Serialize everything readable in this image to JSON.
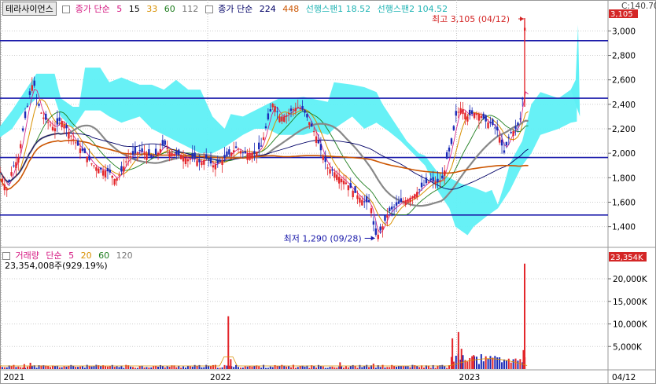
{
  "stock_name": "테라사이언스",
  "price_legend": {
    "ma_label": "종가 단순",
    "ma_periods": [
      {
        "label": "5",
        "color": "#d4147f"
      },
      {
        "label": "15",
        "color": "#000000"
      },
      {
        "label": "33",
        "color": "#d89000"
      },
      {
        "label": "60",
        "color": "#1d7d1d"
      },
      {
        "label": "112",
        "color": "#777777"
      }
    ],
    "ma2_label": "종가 단순",
    "ma2_periods": [
      {
        "label": "224",
        "color": "#000066"
      },
      {
        "label": "448",
        "color": "#cc5500"
      }
    ],
    "span1": "선행스팬1 18.52",
    "span2": "선행스팬2 104.52",
    "span_color": "#22b5b5"
  },
  "current_price_label": "C:140.70",
  "last_price_badge": "3,105",
  "high_annotation": "최고 3,105 (04/12)",
  "low_annotation": "최저 1,290 (09/28)",
  "volume_legend": {
    "label": "거래량",
    "ma_label": "단순",
    "periods": [
      {
        "label": "5",
        "color": "#d4147f"
      },
      {
        "label": "20",
        "color": "#d89000"
      },
      {
        "label": "60",
        "color": "#1d7d1d"
      },
      {
        "label": "120",
        "color": "#777777"
      }
    ]
  },
  "volume_text": "23,354,008주(929.19%)",
  "volume_badge": "23,354K",
  "colors": {
    "up": "#e3262b",
    "down": "#1b2bb8",
    "cloud": "#5ff0f5",
    "hline": "#1a1aaa",
    "badge": "#d42626"
  },
  "chart_data": [
    {
      "type": "candlestick",
      "title": "",
      "y_ticks": [
        "3,000",
        "2,800",
        "2,600",
        "2,400",
        "2,200",
        "2,000",
        "1,800",
        "1,600",
        "1,400"
      ],
      "ylim": [
        1250,
        3150
      ],
      "x_ticks": [
        "2021",
        "2022",
        "2023",
        "04/12"
      ],
      "horizontal_lines": [
        2920,
        2450,
        1965,
        1495
      ],
      "high": {
        "value": 3105,
        "date": "04/12"
      },
      "low": {
        "value": 1290,
        "date": "09/28"
      },
      "close_path": [
        [
          0,
          1850
        ],
        [
          0.006,
          1760
        ],
        [
          0.012,
          1700
        ],
        [
          0.02,
          1870
        ],
        [
          0.03,
          1960
        ],
        [
          0.04,
          2250
        ],
        [
          0.05,
          2500
        ],
        [
          0.055,
          2600
        ],
        [
          0.06,
          2450
        ],
        [
          0.07,
          2300
        ],
        [
          0.08,
          2250
        ],
        [
          0.09,
          2200
        ],
        [
          0.1,
          2280
        ],
        [
          0.11,
          2200
        ],
        [
          0.12,
          2120
        ],
        [
          0.13,
          2050
        ],
        [
          0.14,
          2000
        ],
        [
          0.15,
          1920
        ],
        [
          0.16,
          1880
        ],
        [
          0.17,
          1860
        ],
        [
          0.18,
          1850
        ],
        [
          0.19,
          1780
        ],
        [
          0.2,
          1850
        ],
        [
          0.21,
          1960
        ],
        [
          0.22,
          1990
        ],
        [
          0.23,
          2020
        ],
        [
          0.24,
          2000
        ],
        [
          0.25,
          1960
        ],
        [
          0.26,
          2000
        ],
        [
          0.27,
          2080
        ],
        [
          0.28,
          2010
        ],
        [
          0.29,
          1990
        ],
        [
          0.3,
          1980
        ],
        [
          0.31,
          1950
        ],
        [
          0.32,
          1960
        ],
        [
          0.33,
          1920
        ],
        [
          0.34,
          1960
        ],
        [
          0.35,
          1900
        ],
        [
          0.36,
          1920
        ],
        [
          0.37,
          1960
        ],
        [
          0.38,
          2000
        ],
        [
          0.39,
          2050
        ],
        [
          0.4,
          2000
        ],
        [
          0.41,
          2000
        ],
        [
          0.42,
          2000
        ],
        [
          0.43,
          2050
        ],
        [
          0.44,
          2250
        ],
        [
          0.45,
          2420
        ],
        [
          0.46,
          2300
        ],
        [
          0.47,
          2300
        ],
        [
          0.48,
          2350
        ],
        [
          0.49,
          2380
        ],
        [
          0.5,
          2350
        ],
        [
          0.51,
          2250
        ],
        [
          0.52,
          2150
        ],
        [
          0.53,
          2000
        ],
        [
          0.54,
          1880
        ],
        [
          0.55,
          1850
        ],
        [
          0.56,
          1800
        ],
        [
          0.57,
          1760
        ],
        [
          0.58,
          1700
        ],
        [
          0.59,
          1650
        ],
        [
          0.6,
          1600
        ],
        [
          0.61,
          1600
        ],
        [
          0.615,
          1420
        ],
        [
          0.62,
          1310
        ],
        [
          0.63,
          1400
        ],
        [
          0.64,
          1520
        ],
        [
          0.65,
          1560
        ],
        [
          0.66,
          1600
        ],
        [
          0.67,
          1620
        ],
        [
          0.68,
          1650
        ],
        [
          0.69,
          1700
        ],
        [
          0.7,
          1750
        ],
        [
          0.71,
          1780
        ],
        [
          0.72,
          1760
        ],
        [
          0.73,
          1800
        ],
        [
          0.735,
          1940
        ],
        [
          0.745,
          2100
        ],
        [
          0.75,
          2300
        ],
        [
          0.76,
          2380
        ],
        [
          0.77,
          2300
        ],
        [
          0.78,
          2330
        ],
        [
          0.79,
          2320
        ],
        [
          0.8,
          2260
        ],
        [
          0.81,
          2240
        ],
        [
          0.82,
          2180
        ],
        [
          0.83,
          2000
        ],
        [
          0.84,
          2160
        ],
        [
          0.85,
          2200
        ],
        [
          0.855,
          2250
        ],
        [
          0.86,
          2350
        ],
        [
          0.862,
          2750
        ],
        [
          0.864,
          3105
        ],
        [
          0.866,
          2400
        ],
        [
          0.868,
          2300
        ]
      ],
      "volume": {
        "y_ticks": [
          "20,000K",
          "15,000K",
          "10,000K",
          "5,000K"
        ],
        "ylim": [
          0,
          24000
        ],
        "spikes": [
          {
            "x": 0.04,
            "value": 1100
          },
          {
            "x": 0.05,
            "value": 1400
          },
          {
            "x": 0.376,
            "value": 11700
          },
          {
            "x": 0.38,
            "value": 2200
          },
          {
            "x": 0.56,
            "value": 1500
          },
          {
            "x": 0.615,
            "value": 1200
          },
          {
            "x": 0.745,
            "value": 6800
          },
          {
            "x": 0.755,
            "value": 8200
          },
          {
            "x": 0.76,
            "value": 4500
          },
          {
            "x": 0.78,
            "value": 3100
          },
          {
            "x": 0.862,
            "value": 4200
          },
          {
            "x": 0.864,
            "value": 23354
          }
        ]
      }
    }
  ]
}
